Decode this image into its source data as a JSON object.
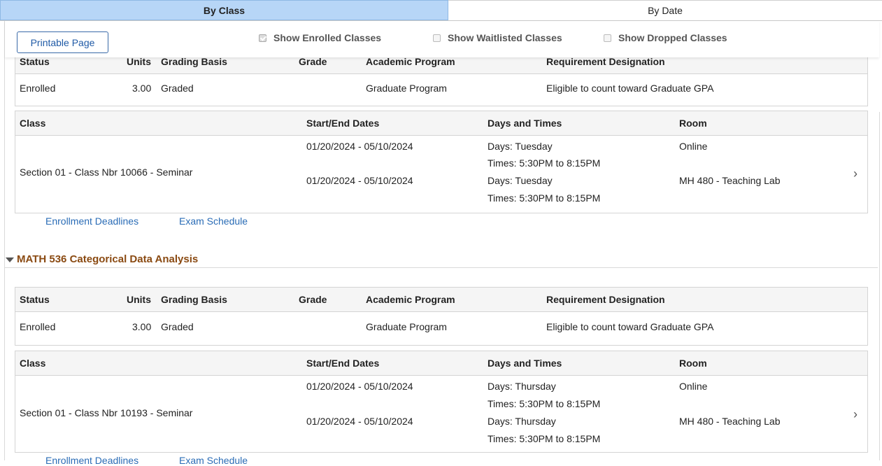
{
  "tabs": [
    {
      "label": "By Class",
      "active": true
    },
    {
      "label": "By Date",
      "active": false
    }
  ],
  "toolbar": {
    "printable_label": "Printable Page",
    "show_enrolled": {
      "label": "Show Enrolled Classes",
      "checked": true
    },
    "show_waitlisted": {
      "label": "Show Waitlisted Classes",
      "checked": false
    },
    "show_dropped": {
      "label": "Show Dropped Classes",
      "checked": false
    }
  },
  "summary_headers": {
    "status": "Status",
    "units": "Units",
    "grading": "Grading Basis",
    "grade": "Grade",
    "program": "Academic Program",
    "requirement": "Requirement Designation"
  },
  "class_headers": {
    "class": "Class",
    "dates": "Start/End Dates",
    "days_times": "Days and Times",
    "room": "Room"
  },
  "links": {
    "deadlines": "Enrollment Deadlines",
    "exam": "Exam Schedule"
  },
  "courses": [
    {
      "title": "",
      "summary": {
        "status": "Enrolled",
        "units": "3.00",
        "grading": "Graded",
        "grade": "",
        "program": "Graduate Program",
        "requirement": "Eligible to count toward Graduate GPA"
      },
      "section": "Section 01 - Class Nbr 10066 - Seminar",
      "meetings": [
        {
          "dates": "01/20/2024 - 05/10/2024",
          "days": "Days: Tuesday",
          "times": "Times: 5:30PM to 8:15PM",
          "room": "Online"
        },
        {
          "dates": "01/20/2024 - 05/10/2024",
          "days": "Days: Tuesday",
          "times": "Times: 5:30PM to 8:15PM",
          "room": "MH 480 - Teaching Lab"
        }
      ]
    },
    {
      "title": "MATH 536 Categorical Data Analysis",
      "summary": {
        "status": "Enrolled",
        "units": "3.00",
        "grading": "Graded",
        "grade": "",
        "program": "Graduate Program",
        "requirement": "Eligible to count toward Graduate GPA"
      },
      "section": "Section 01 - Class Nbr 10193 - Seminar",
      "meetings": [
        {
          "dates": "01/20/2024 - 05/10/2024",
          "days": "Days: Thursday",
          "times": "Times: 5:30PM to 8:15PM",
          "room": "Online"
        },
        {
          "dates": "01/20/2024 - 05/10/2024",
          "days": "Days: Thursday",
          "times": "Times: 5:30PM to 8:15PM",
          "room": "MH 480 - Teaching Lab"
        }
      ]
    }
  ]
}
